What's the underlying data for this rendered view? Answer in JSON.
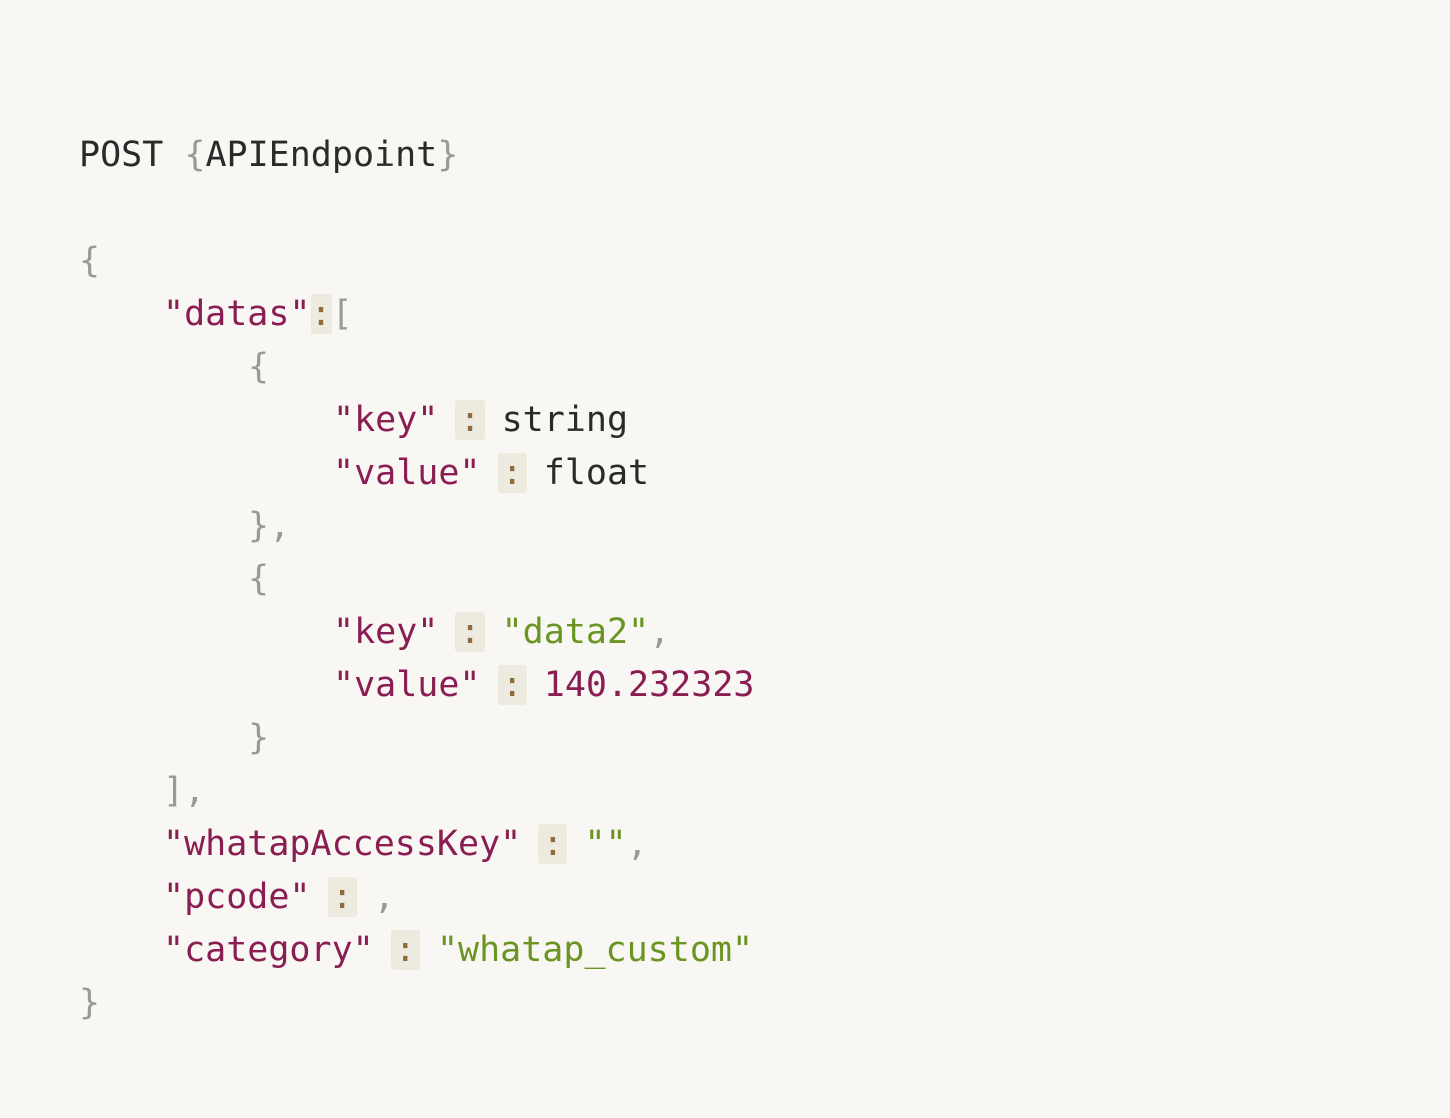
{
  "request": {
    "method": "POST",
    "endpoint_open": "{",
    "endpoint_name": "APIEndpoint",
    "endpoint_close": "}"
  },
  "json_body": {
    "open_brace": "{",
    "datas_key": "\"datas\"",
    "colon": ":",
    "array_open": "[",
    "item_open": "{",
    "item1_close": "},",
    "item2_close": "}",
    "array_close": "],",
    "close_brace": "}",
    "comma": ",",
    "items": [
      {
        "key_label": "\"key\"",
        "key_value": "string",
        "value_label": "\"value\"",
        "value_value": "float"
      },
      {
        "key_label": "\"key\"",
        "key_value": "\"data2\"",
        "value_label": "\"value\"",
        "value_value": "140.232323"
      }
    ],
    "access_key_label": "\"whatapAccessKey\"",
    "access_key_value": "\"\"",
    "pcode_label": "\"pcode\"",
    "category_label": "\"category\"",
    "category_value": "\"whatap_custom\""
  },
  "colors": {
    "background": "#f8f7f3",
    "key": "#8a1d52",
    "string": "#6b9523",
    "punctuation": "#999999",
    "colon": "#8f6a3a"
  }
}
